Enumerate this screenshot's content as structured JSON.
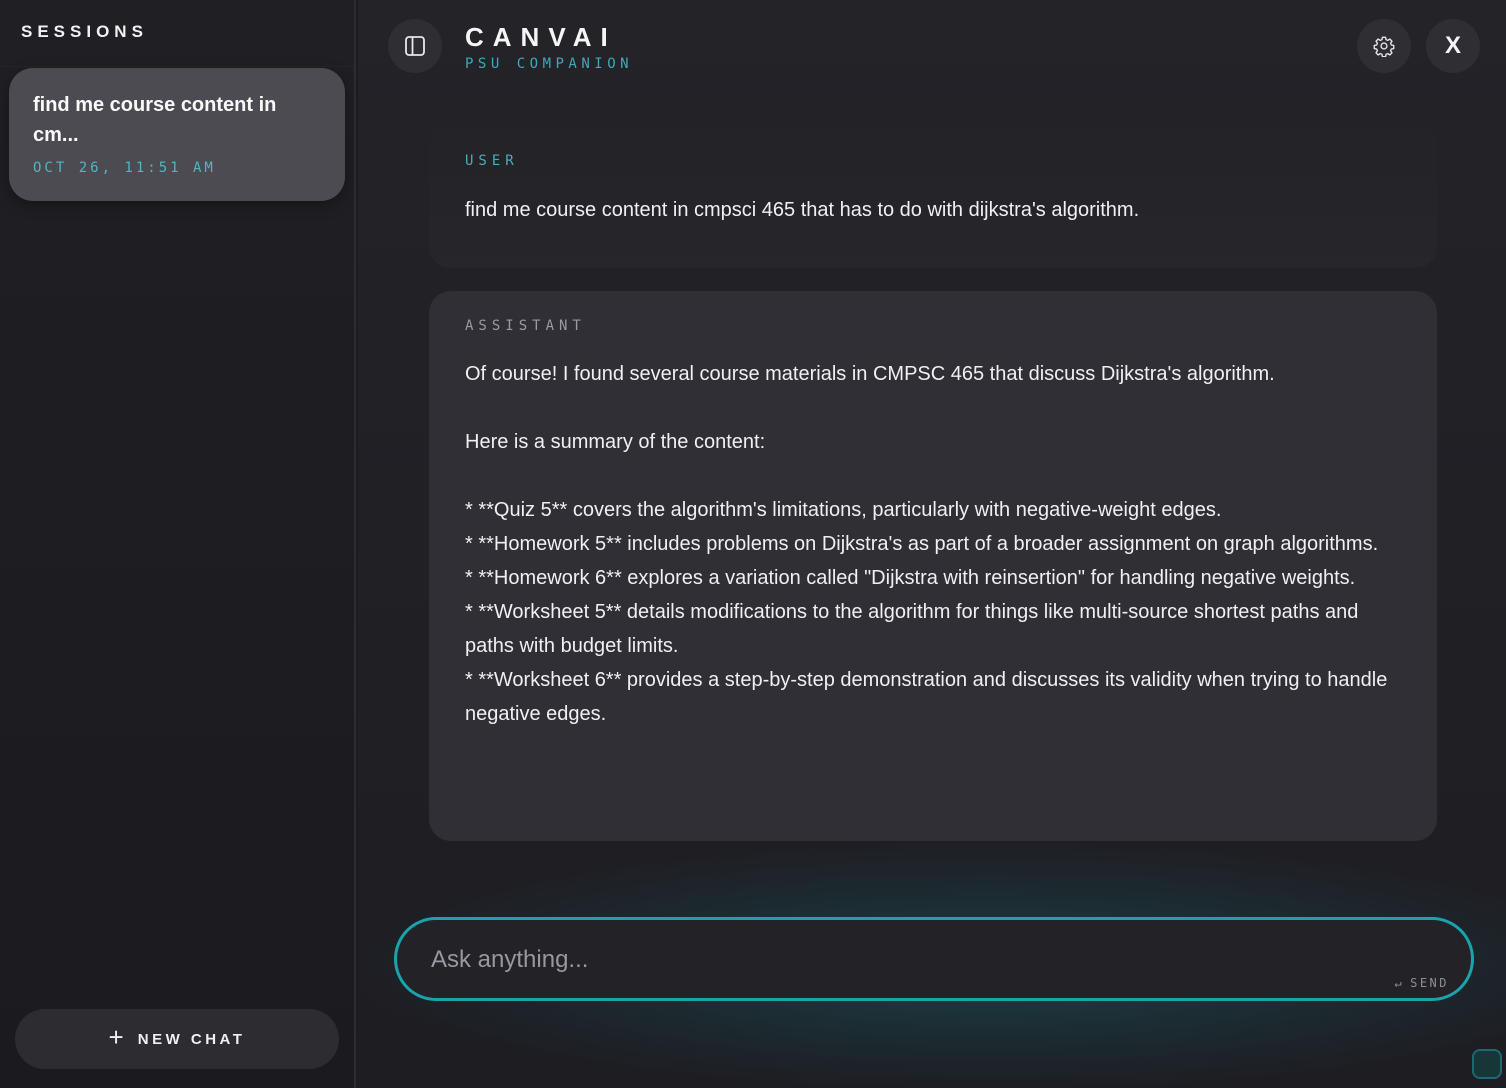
{
  "sidebar": {
    "title": "SESSIONS",
    "sessions": [
      {
        "title": "find me course content in cm...",
        "date": "OCT 26, 11:51 AM"
      }
    ],
    "new_chat_icon": "+",
    "new_chat_label": "NEW CHAT"
  },
  "header": {
    "title": "CANVAI",
    "subtitle": "PSU COMPANION",
    "toggle_icon": "sidebar-toggle-icon",
    "settings_icon": "gear-icon",
    "close_label": "X"
  },
  "messages": [
    {
      "role": "USER",
      "text": "find me course content in cmpsci 465 that has to do with dijkstra's algorithm."
    },
    {
      "role": "ASSISTANT",
      "intro": "Of course! I found several course materials in CMPSC 465 that discuss Dijkstra's algorithm.",
      "summary": "Here is a summary of the content:",
      "bullets": [
        "*   **Quiz 5** covers the algorithm's limitations, particularly with negative-weight edges.",
        "*   **Homework 5** includes problems on Dijkstra's as part of a broader assignment on graph algorithms.",
        "*   **Homework 6** explores a variation called \"Dijkstra with reinsertion\" for handling negative weights.",
        "*   **Worksheet 5** details modifications to the algorithm for things like multi-source shortest paths and paths with budget limits.",
        "*   **Worksheet 6** provides a step-by-step demonstration and discusses its validity when trying to handle negative edges."
      ]
    }
  ],
  "composer": {
    "placeholder": "Ask anything...",
    "value": "",
    "send_icon": "↵",
    "send_label": "SEND"
  },
  "colors": {
    "accent": "#1aa3ad",
    "accent_text": "#3fa9b6",
    "background": "#1d1d22",
    "card": "#2f2f35",
    "session_active": "#4b4b51"
  }
}
